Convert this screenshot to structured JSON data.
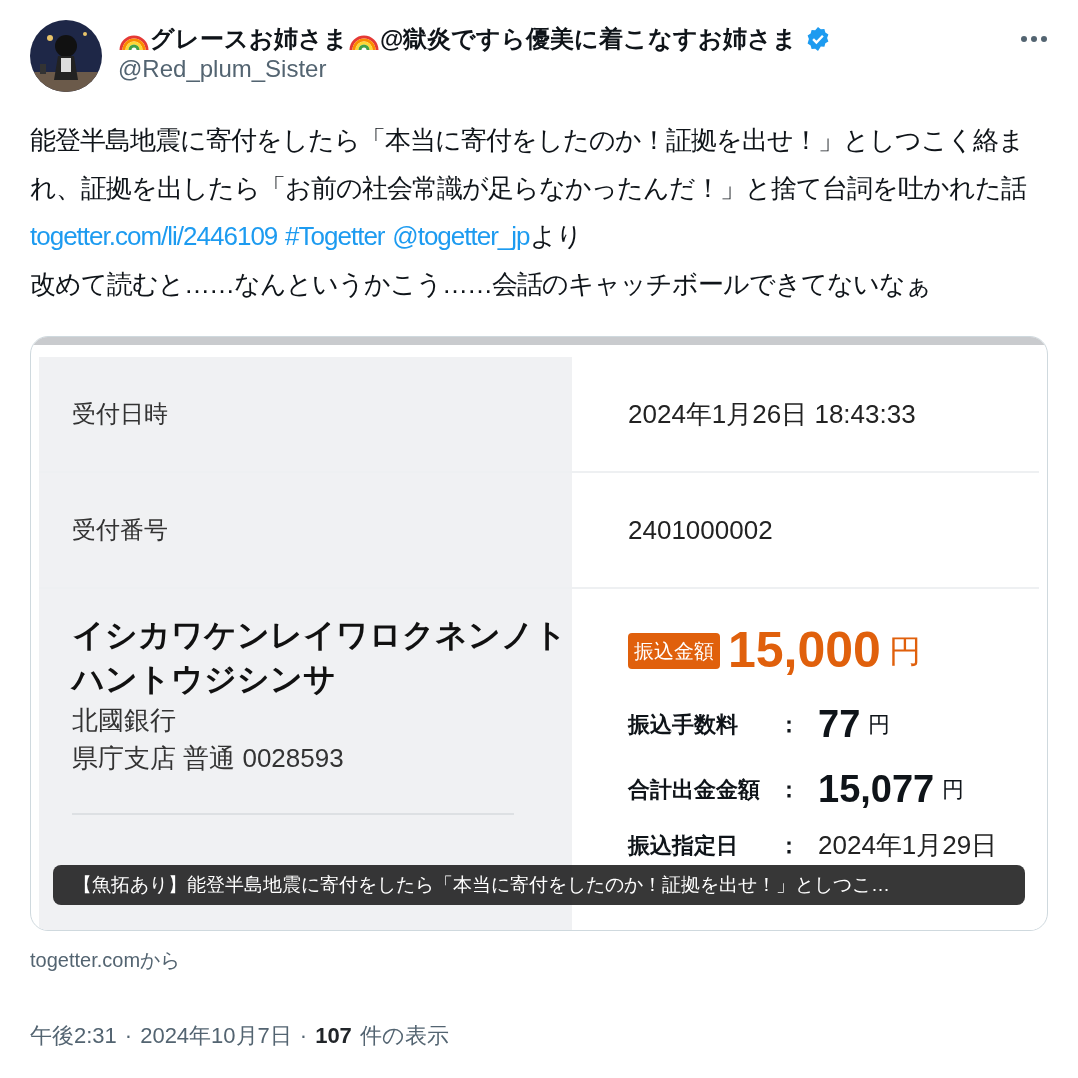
{
  "author": {
    "name_parts": [
      "グレースお姉さま",
      "@獄炎ですら優美に着こなすお姉さま"
    ],
    "verified": true,
    "handle": "@Red_plum_Sister"
  },
  "more_button": {
    "kind": "dots"
  },
  "tweet": {
    "paragraphs": [
      [
        {
          "kind": "text",
          "text": "能登半島地震に寄付をしたら「本当に寄付をしたのか！証拠を出せ！」としつこく絡まれ、証拠を出したら「お前の社会常識が足らなかったんだ！」と捨て台詞を吐かれた話 "
        },
        {
          "kind": "link",
          "text": "togetter.com/li/2446109"
        },
        {
          "kind": "link",
          "text": "#Togetter"
        },
        {
          "kind": "link",
          "text": "@togetter_jp"
        },
        {
          "kind": "text",
          "text": "より"
        }
      ],
      [
        {
          "kind": "text",
          "text": "改めて読むと……なんというかこう……会話のキャッチボールできてないなぁ"
        }
      ]
    ]
  },
  "card": {
    "rows": [
      {
        "label": "受付日時",
        "value": "2024年1月26日 18:43:33"
      },
      {
        "label": "受付番号",
        "value": "2401000002"
      }
    ],
    "recipient": {
      "name_lines": [
        "イシカワケンレイワロクネンノト",
        "ハントウジシンサ"
      ],
      "bank_lines": [
        "北國銀行",
        "県庁支店 普通 0028593"
      ]
    },
    "amount": {
      "badge": "振込金額",
      "value": "15,000",
      "unit": "円"
    },
    "details": [
      {
        "label": "振込手数料",
        "colon": "：",
        "value": "77",
        "unit": "円"
      },
      {
        "label": "合計出金金額",
        "colon": "：",
        "value": "15,077",
        "unit": "円"
      },
      {
        "label": "振込指定日",
        "colon": "：",
        "value": "2024年1月29日"
      }
    ],
    "caption": "【魚拓あり】能登半島地震に寄付をしたら「本当に寄付をしたのか！証拠を出せ！」としつこ…"
  },
  "source": "togetter.comから",
  "footer": {
    "time": "午後2:31",
    "separator": "·",
    "date": "2024年10月7日",
    "separator_2": "·",
    "views": "107",
    "views_label": "件の表示"
  }
}
